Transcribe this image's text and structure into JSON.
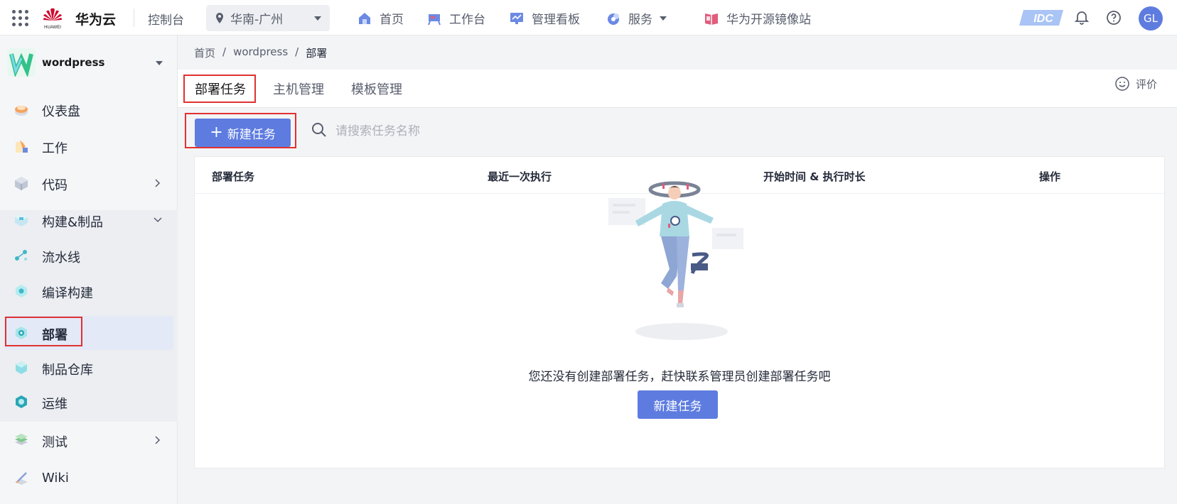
{
  "header": {
    "brand": "华为云",
    "logo_text": "HUAWEI",
    "console": "控制台",
    "region": "华南-广州",
    "nav": [
      {
        "label": "首页",
        "icon": "home-icon"
      },
      {
        "label": "工作台",
        "icon": "workbench-icon"
      },
      {
        "label": "管理看板",
        "icon": "dashboard-icon"
      },
      {
        "label": "服务",
        "icon": "service-icon"
      },
      {
        "label": "华为开源镜像站",
        "icon": "mirror-icon"
      }
    ],
    "idc_badge": "IDC",
    "avatar": "GL"
  },
  "sidebar": {
    "project": "wordpress",
    "items": [
      {
        "label": "仪表盘",
        "icon": "gauge-icon"
      },
      {
        "label": "工作",
        "icon": "work-icon"
      },
      {
        "label": "代码",
        "icon": "code-icon"
      },
      {
        "label": "构建&制品",
        "icon": "build-icon"
      },
      {
        "label": "流水线",
        "icon": "pipeline-icon"
      },
      {
        "label": "编译构建",
        "icon": "compile-icon"
      },
      {
        "label": "部署",
        "icon": "deploy-icon"
      },
      {
        "label": "制品仓库",
        "icon": "artifact-icon"
      },
      {
        "label": "运维",
        "icon": "ops-icon"
      },
      {
        "label": "测试",
        "icon": "test-icon"
      },
      {
        "label": "Wiki",
        "icon": "wiki-icon"
      }
    ]
  },
  "main": {
    "breadcrumb": [
      "首页",
      "wordpress",
      "部署"
    ],
    "tabs": [
      "部署任务",
      "主机管理",
      "模板管理"
    ],
    "feedback": "评价",
    "new_task_button": "新建任务",
    "search_placeholder": "请搜索任务名称",
    "table_headers": [
      "部署任务",
      "最近一次执行",
      "开始时间 & 执行时长",
      "操作"
    ],
    "empty_message": "您还没有创建部署任务，赶快联系管理员创建部署任务吧",
    "empty_button": "新建任务"
  },
  "colors": {
    "primary": "#5e7ce0",
    "highlight_border": "#e03131"
  }
}
